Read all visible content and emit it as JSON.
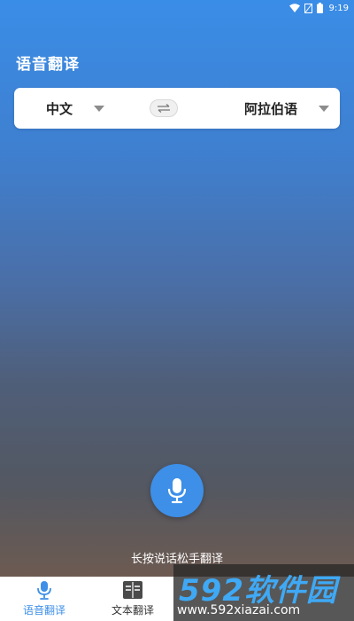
{
  "status_bar": {
    "time": "9:19",
    "icons": [
      "wifi-icon",
      "signal-off-icon",
      "battery-icon"
    ]
  },
  "header": {
    "title": "语音翻译"
  },
  "language_selector": {
    "source": "中文",
    "target": "阿拉伯语",
    "swap_glyph": "⇆"
  },
  "main": {
    "mic_icon": "microphone-icon",
    "hint": "长按说话松手翻译"
  },
  "bottom_nav": {
    "items": [
      {
        "label": "语音翻译",
        "icon": "microphone-icon",
        "active": true
      },
      {
        "label": "文本翻译",
        "icon": "book-icon",
        "active": false
      }
    ]
  },
  "watermark": {
    "brand": "592软件园",
    "url": "www.592xiazai.com"
  },
  "colors": {
    "accent": "#3d8fe8",
    "card": "#ffffff",
    "text_dark": "#222222",
    "caret": "#8c8c8c"
  }
}
